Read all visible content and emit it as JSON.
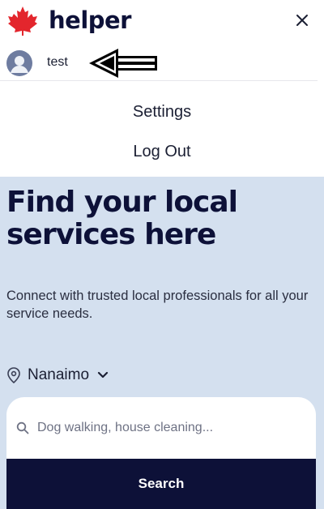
{
  "header": {
    "brand": "helper",
    "logo_icon": "maple-leaf-icon",
    "close_icon": "close-icon"
  },
  "user": {
    "name": "test",
    "avatar_icon": "user-avatar-icon"
  },
  "menu": {
    "items": [
      {
        "label": "Settings"
      },
      {
        "label": "Log Out"
      }
    ]
  },
  "hero": {
    "title": "Find your local services here",
    "subtitle": "Connect with trusted local professionals for all your service needs."
  },
  "location": {
    "city": "Nanaimo",
    "pin_icon": "location-pin-icon",
    "chevron_icon": "chevron-down-icon"
  },
  "search": {
    "placeholder": "Dog walking, house cleaning...",
    "value": "",
    "button_label": "Search",
    "icon": "search-icon"
  },
  "colors": {
    "brand_red": "#e3262d",
    "navy": "#0d1138",
    "hero_bg": "#d4e0ef"
  }
}
